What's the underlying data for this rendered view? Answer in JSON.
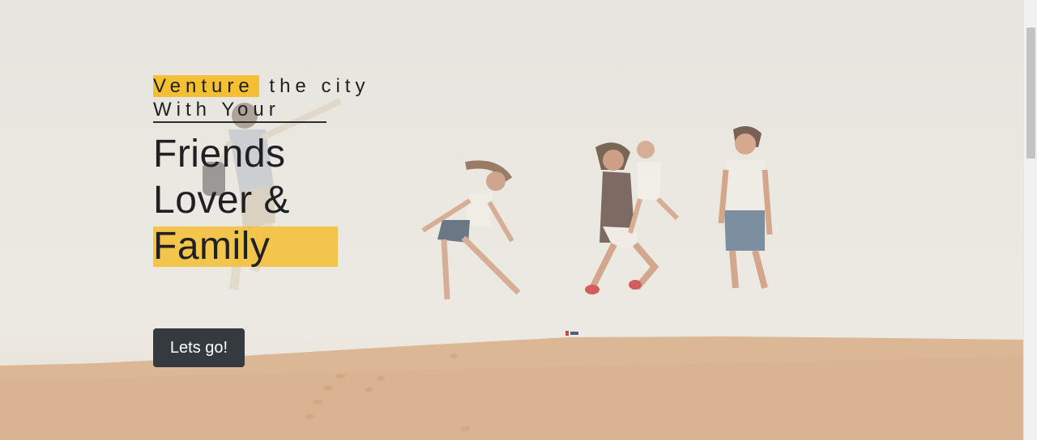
{
  "hero": {
    "tagline_highlight": "Venture",
    "tagline_rest": "the city",
    "tagline_line2": "With Your",
    "headline_line1": "Friends",
    "headline_line2": "Lover &",
    "headline_line3": "Family",
    "cta_label": "Lets go!"
  },
  "colors": {
    "accent": "#f5bf33",
    "button": "#343a40",
    "text": "#1f2024",
    "sand": "#dcb693"
  }
}
